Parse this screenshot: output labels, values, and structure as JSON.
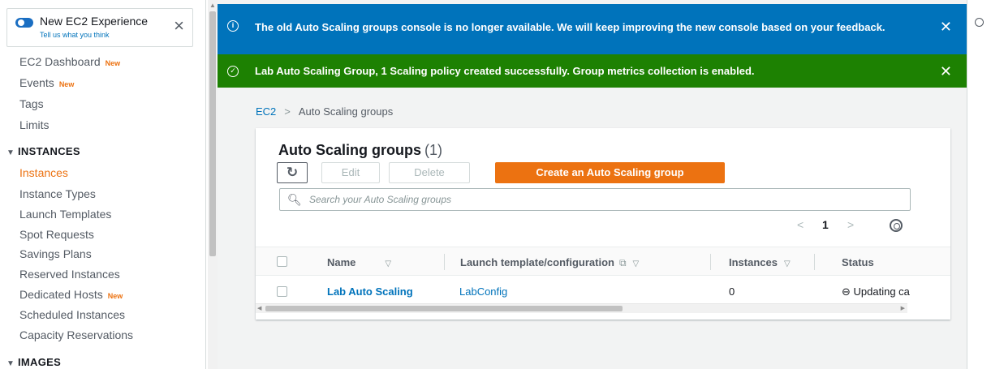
{
  "sidebar": {
    "experience_title": "New EC2 Experience",
    "experience_sub": "Tell us what you think",
    "items": [
      {
        "label": "EC2 Dashboard",
        "badge": "New"
      },
      {
        "label": "Events",
        "badge": "New"
      },
      {
        "label": "Tags"
      },
      {
        "label": "Limits"
      }
    ],
    "sections": [
      {
        "title": "INSTANCES",
        "items": [
          {
            "label": "Instances",
            "active": true
          },
          {
            "label": "Instance Types"
          },
          {
            "label": "Launch Templates"
          },
          {
            "label": "Spot Requests"
          },
          {
            "label": "Savings Plans"
          },
          {
            "label": "Reserved Instances"
          },
          {
            "label": "Dedicated Hosts",
            "badge": "New"
          },
          {
            "label": "Scheduled Instances"
          },
          {
            "label": "Capacity Reservations"
          }
        ]
      },
      {
        "title": "IMAGES"
      }
    ]
  },
  "flash": {
    "info_text": "The old Auto Scaling groups console is no longer available. We will keep improving the new console based on your feedback.",
    "success_text": "Lab Auto Scaling Group, 1 Scaling policy created successfully. Group metrics collection is enabled."
  },
  "breadcrumb": {
    "root": "EC2",
    "current": "Auto Scaling groups"
  },
  "panel": {
    "title": "Auto Scaling groups",
    "count": "(1)",
    "edit_label": "Edit",
    "delete_label": "Delete",
    "create_label": "Create an Auto Scaling group",
    "search_placeholder": "Search your Auto Scaling groups",
    "page": "1"
  },
  "table": {
    "columns": [
      "Name",
      "Launch template/configuration",
      "Instances",
      "Status"
    ],
    "rows": [
      {
        "name": "Lab Auto Scaling",
        "launch": "LabConfig",
        "instances": "0",
        "status": "Updating ca"
      }
    ]
  },
  "colors": {
    "info": "#0073bb",
    "success": "#1d8102",
    "primary": "#ec7211",
    "link": "#0073bb"
  }
}
